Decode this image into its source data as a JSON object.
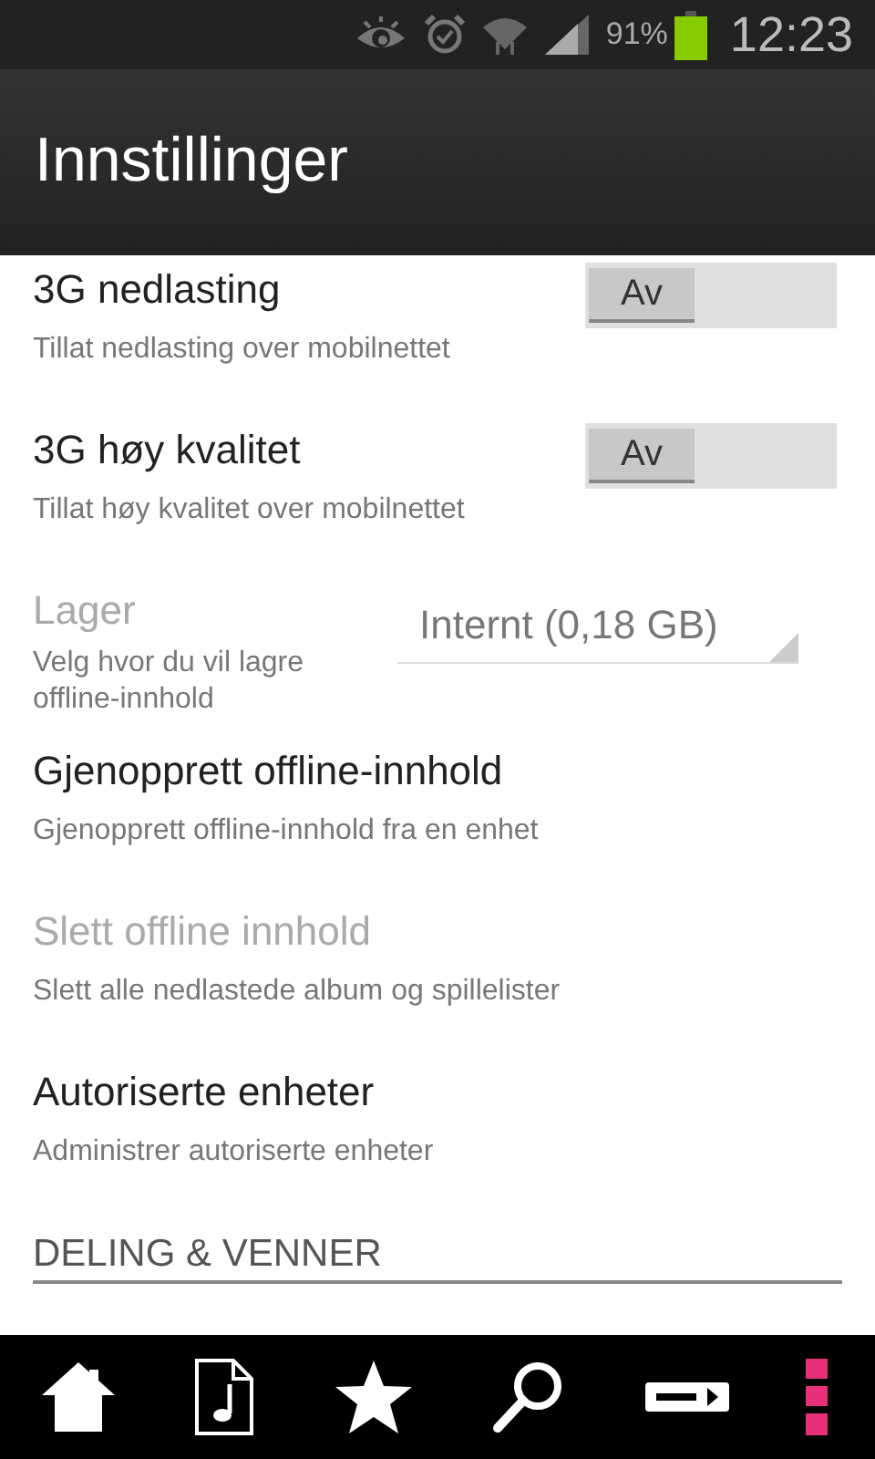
{
  "status_bar": {
    "battery": "91%",
    "time": "12:23"
  },
  "title": "Innstillinger",
  "settings": [
    {
      "kind": "toggle",
      "title": "3G nedlasting",
      "subtitle": "Tillat nedlasting over mobilnettet",
      "disabled": false,
      "on": false,
      "value": "Av"
    },
    {
      "kind": "toggle",
      "title": "3G høy kvalitet",
      "subtitle": "Tillat høy kvalitet over mobilnettet",
      "disabled": false,
      "on": false,
      "value": "Av"
    },
    {
      "kind": "dropdown",
      "title": "Lager",
      "subtitle": "Velg hvor du vil lagre offline-innhold",
      "disabled": true,
      "value": "Internt (0,18 GB)"
    },
    {
      "kind": "plain",
      "title": "Gjenopprett offline-innhold",
      "subtitle": "Gjenopprett offline-innhold fra en enhet",
      "disabled": false
    },
    {
      "kind": "plain",
      "title": "Slett offline innhold",
      "subtitle": "Slett alle nedlastede album og spillelister",
      "disabled": true
    },
    {
      "kind": "plain",
      "title": "Autoriserte enheter",
      "subtitle": "Administrer autoriserte enheter",
      "disabled": false
    }
  ],
  "section_header": "DELING & VENNER"
}
